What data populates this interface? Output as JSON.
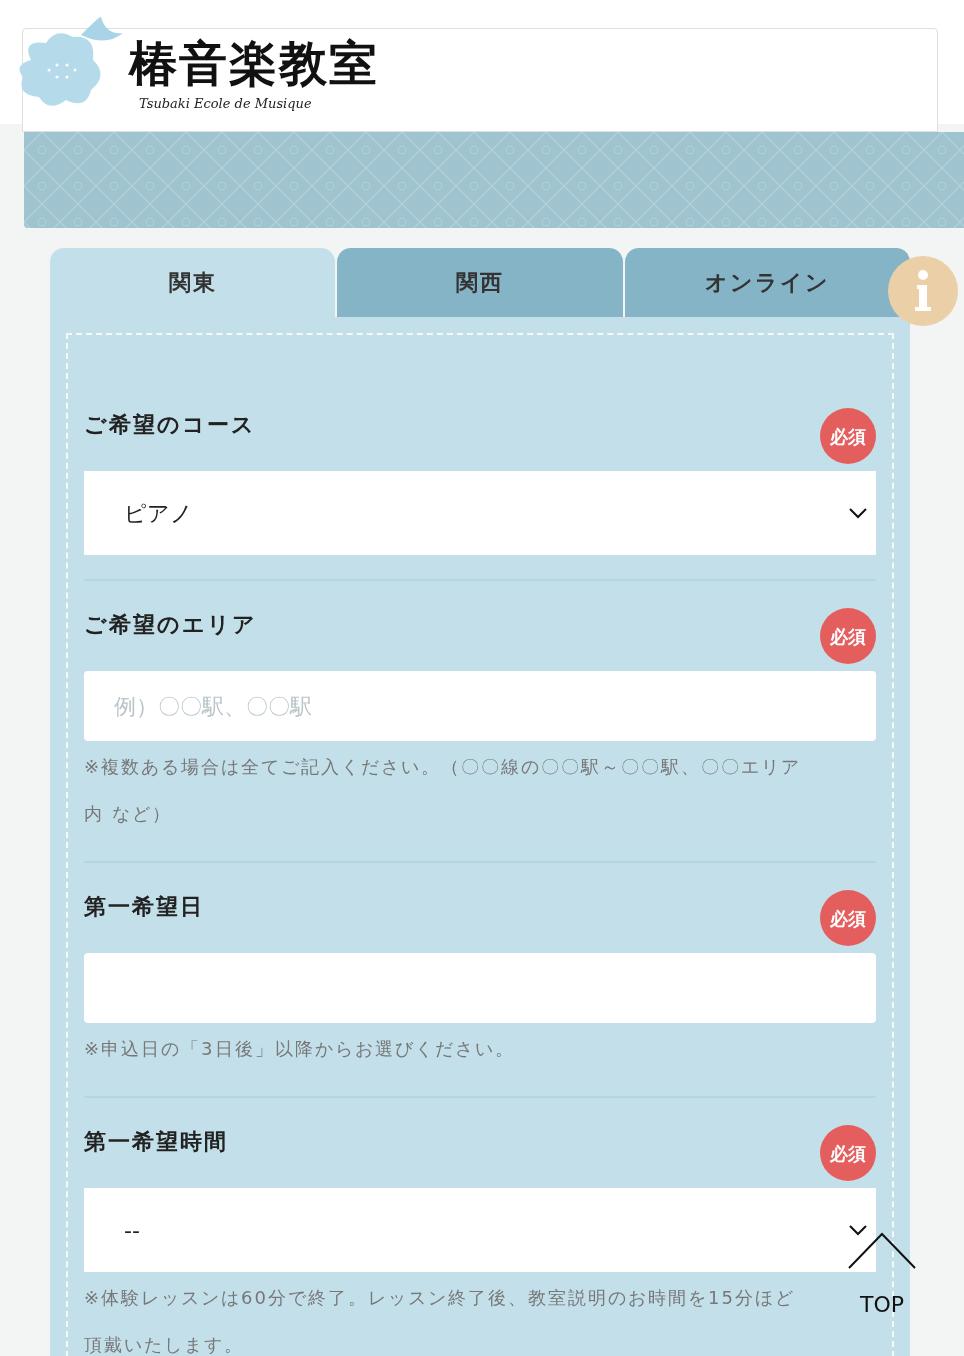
{
  "header": {
    "logo_title": "椿音楽教室",
    "logo_subtitle": "Tsubaki Ecole de Musique"
  },
  "tabs": [
    {
      "label": "関東",
      "selected": true
    },
    {
      "label": "関西",
      "selected": false
    },
    {
      "label": "オンライン",
      "selected": false
    }
  ],
  "fields": [
    {
      "kind": "select",
      "label": "ご希望のコース",
      "badge": "必須",
      "value": "ピアノ"
    },
    {
      "kind": "text",
      "label": "ご希望のエリア",
      "badge": "必須",
      "placeholder": "例）〇〇駅、〇〇駅",
      "note": "※複数ある場合は全てご記入ください。（〇〇線の〇〇駅～〇〇駅、〇〇エリア内 など）"
    },
    {
      "kind": "text",
      "label": "第一希望日",
      "badge": "必須",
      "note": "※申込日の「3日後」以降からお選びください。"
    },
    {
      "kind": "select",
      "label": "第一希望時間",
      "badge": "必須",
      "value": "--",
      "note": "※体験レッスンは60分で終了。レッスン終了後、教室説明のお時間を15分ほど頂戴いたします。"
    }
  ],
  "top_button": {
    "label": "TOP"
  }
}
